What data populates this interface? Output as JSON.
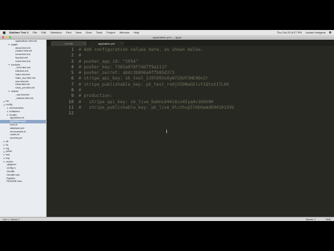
{
  "menubar": {
    "app": "Sublime Text 2",
    "items": [
      "File",
      "Edit",
      "Selection",
      "Find",
      "View",
      "Goto",
      "Tools",
      "Project",
      "Window",
      "Help"
    ],
    "clock": "Thu Oct 25 8:27 PM",
    "user": "Jordan Hudgens"
  },
  "window": {
    "title": "application.yml — apps"
  },
  "sidebar": {
    "rows": [
      {
        "label": "applications.html.erb",
        "kind": "file",
        "indent": 6
      },
      {
        "label": "pages",
        "kind": "folder",
        "indent": 4
      },
      {
        "label": "about.html.erb",
        "kind": "file",
        "indent": 6
      },
      {
        "label": "contact.html.erb",
        "kind": "file",
        "indent": 6
      },
      {
        "label": "home.html.erb",
        "kind": "file",
        "indent": 6
      },
      {
        "label": "faq.html.erb",
        "kind": "file",
        "indent": 6
      },
      {
        "label": "home.html.erb",
        "kind": "file",
        "indent": 6
      },
      {
        "label": "products",
        "kind": "folder",
        "indent": 4
      },
      {
        "label": "_form.html.erb",
        "kind": "file",
        "indent": 6
      },
      {
        "label": "edit.html.erb",
        "kind": "file",
        "indent": 6
      },
      {
        "label": "index.html.erb",
        "kind": "file",
        "indent": 6
      },
      {
        "label": "index_duo.html.erb",
        "kind": "file",
        "indent": 6
      },
      {
        "label": "new.html.erb",
        "kind": "file",
        "indent": 6
      },
      {
        "label": "show.html.erb",
        "kind": "file",
        "indent": 6
      },
      {
        "label": "show_pre.html.erb",
        "kind": "file",
        "indent": 6
      },
      {
        "label": "shared",
        "kind": "folder",
        "indent": 4
      },
      {
        "label": "_nav.html.erb",
        "kind": "file",
        "indent": 6
      },
      {
        "label": "_sidebar.html.erb",
        "kind": "file",
        "indent": 6
      },
      {
        "label": "bin",
        "kind": "folder-closed",
        "indent": 1
      },
      {
        "label": "config",
        "kind": "folder",
        "indent": 1
      },
      {
        "label": "environments",
        "kind": "folder-closed",
        "indent": 3
      },
      {
        "label": "initializers",
        "kind": "folder-closed",
        "indent": 3
      },
      {
        "label": "locales",
        "kind": "folder-closed",
        "indent": 3
      },
      {
        "label": "application.rb",
        "kind": "file",
        "indent": 3
      },
      {
        "label": "application.yml",
        "kind": "file",
        "indent": 3,
        "selected": true
      },
      {
        "label": "boot.rb",
        "kind": "file",
        "indent": 3
      },
      {
        "label": "database.yml",
        "kind": "file",
        "indent": 3
      },
      {
        "label": "environment.rb",
        "kind": "file",
        "indent": 3
      },
      {
        "label": "routes.rb",
        "kind": "file",
        "indent": 3
      },
      {
        "label": "secrets.yml",
        "kind": "file",
        "indent": 3
      },
      {
        "label": "db",
        "kind": "folder-closed",
        "indent": 1
      },
      {
        "label": "lib",
        "kind": "folder-closed",
        "indent": 1
      },
      {
        "label": "log",
        "kind": "folder-closed",
        "indent": 1
      },
      {
        "label": "public",
        "kind": "folder-closed",
        "indent": 1
      },
      {
        "label": "test",
        "kind": "folder-closed",
        "indent": 1
      },
      {
        "label": "tmp",
        "kind": "folder-closed",
        "indent": 1
      },
      {
        "label": "vendor",
        "kind": "folder-closed",
        "indent": 1
      },
      {
        "label": ".gitignore",
        "kind": "file",
        "indent": 1
      },
      {
        "label": "config.ru",
        "kind": "file",
        "indent": 1
      },
      {
        "label": "Gemfile",
        "kind": "file",
        "indent": 1
      },
      {
        "label": "Gemfile.lock",
        "kind": "file",
        "indent": 1
      },
      {
        "label": "Rakefile",
        "kind": "file",
        "indent": 1
      },
      {
        "label": "README.rdoc",
        "kind": "file",
        "indent": 1
      }
    ]
  },
  "tabs": [
    {
      "label": "Gemfile",
      "active": false
    },
    {
      "label": "application.yml",
      "active": true
    }
  ],
  "editor": {
    "lines": [
      "# Add configuration values here, as shown below.",
      "#",
      "# pusher_app_id: \"2954\"",
      "# pusher_key: 7381a978f7dd7f9a1117",
      "# pusher_secret: abdc3b896a0ffb85d373",
      "# stripe_api_key: sk_test_2J0l093vOyW72XUY3HE4Dv2r",
      "# stripe_publishable_key: pk_test_ro0jV59NwGklvY1QtoS17LhK",
      "#",
      "# production:",
      "#   stripe_api_key: sk_live_EeHnL644i6zo4Iyq4v1KdV9H",
      "#   stripe_publishable_key: pk_live_9lcthxp5lHbGwmdD94101XVU",
      ""
    ]
  },
  "statusbar": {
    "left": "Line 1, Column 1",
    "spaces": "Spaces: 2",
    "syntax": "YAML"
  }
}
